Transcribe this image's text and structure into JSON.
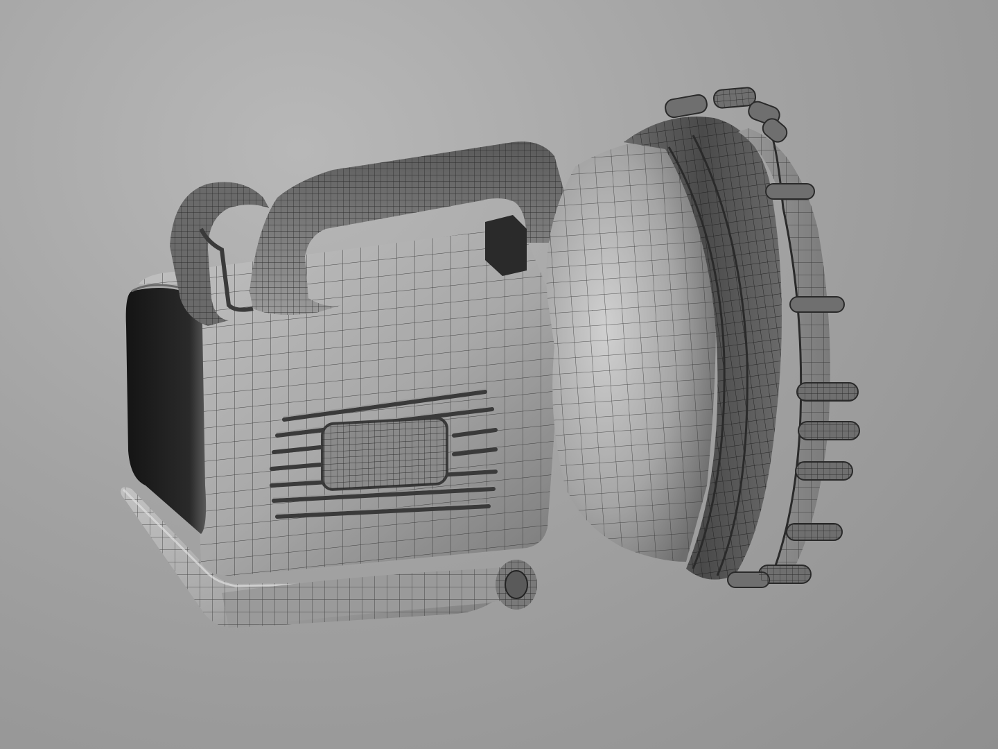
{
  "scene": {
    "subject": "",
    "render_style": "wireframe-on-shaded",
    "colors": {
      "background_light": "#b8b8b8",
      "background_dark": "#8f8f8f",
      "shell_light": "#b5b5b5",
      "shell_mid": "#8a8a8a",
      "shell_dark": "#3a3a3a",
      "wire": "#2a2a2a",
      "rubber": "#555555"
    }
  }
}
